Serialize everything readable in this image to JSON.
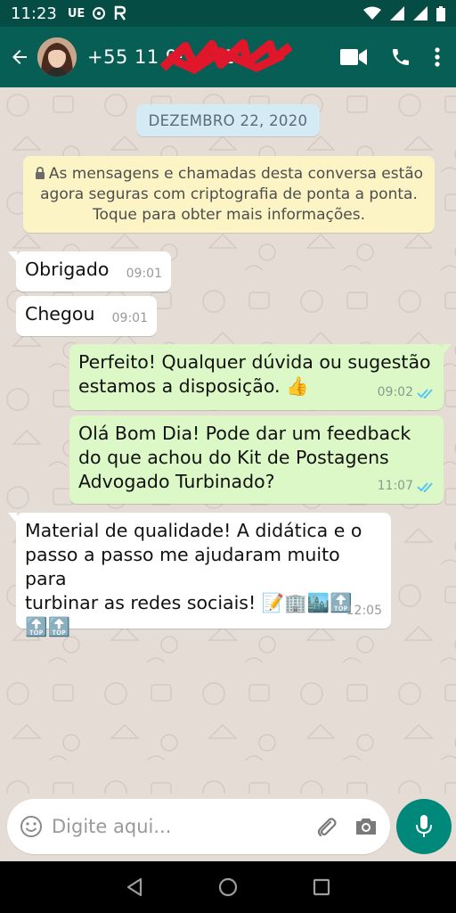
{
  "status_bar": {
    "time": "11:23",
    "carrier_tag": "UE"
  },
  "header": {
    "contact_name": "+55 11 9·······12",
    "actions": [
      "video-call",
      "voice-call",
      "more-options"
    ]
  },
  "chat": {
    "date_label": "DEZEMBRO 22, 2020",
    "encryption_notice": "As mensagens e chamadas desta conversa estão agora seguras com criptografia de ponta a ponta. Toque para obter mais informações.",
    "messages": [
      {
        "direction": "in",
        "text": "Obrigado",
        "time": "09:01"
      },
      {
        "direction": "in",
        "text": "Chegou",
        "time": "09:01"
      },
      {
        "direction": "out",
        "text": "Perfeito! Qualquer dúvida ou sugestão\nestamos a disposição. 👍",
        "time": "09:02",
        "status": "read"
      },
      {
        "direction": "out",
        "text": "Olá Bom Dia! Pode dar um feedback\ndo que achou do Kit de Postagens\nAdvogado Turbinado?",
        "time": "11:07",
        "status": "read"
      },
      {
        "direction": "in",
        "text": "Material de qualidade! A didática e o\npasso a passo me ajudaram muito para\nturbinar as redes sociais! 📝🏢🏙️🔝\n🔝🔝",
        "time": "12:05"
      }
    ]
  },
  "composer": {
    "placeholder": "Digite aqui..."
  },
  "colors": {
    "header": "#075e54",
    "status_bar": "#054d44",
    "outgoing_bubble": "#dcf8c6",
    "incoming_bubble": "#ffffff",
    "chat_background": "#e5ddd5",
    "mic_button": "#00897b",
    "read_ticks": "#4fc3f7"
  }
}
